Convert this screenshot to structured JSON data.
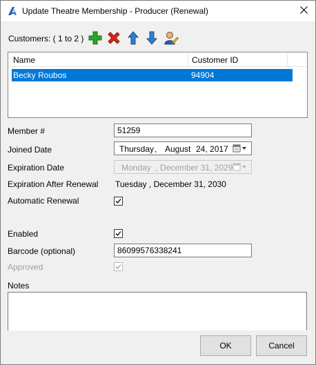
{
  "window": {
    "title": "Update Theatre Membership - Producer (Renewal)",
    "app_icon": "app-logo-icon",
    "close_icon": "close-icon"
  },
  "customers": {
    "label": "Customers:  ( 1 to 2 )",
    "toolbar_icons": [
      "add-icon",
      "delete-icon",
      "move-up-icon",
      "move-down-icon",
      "edit-user-icon"
    ],
    "columns": [
      "Name",
      "Customer ID"
    ],
    "rows": [
      {
        "name": "Becky Roubos",
        "customer_id": "94904",
        "selected": true
      }
    ]
  },
  "form": {
    "member_number": {
      "label": "Member #",
      "value": "51259"
    },
    "joined_date": {
      "label": "Joined Date",
      "weekday": "Thursday",
      "sep": ",",
      "month": "August",
      "day_year": "24, 2017"
    },
    "expiration_date": {
      "label": "Expiration Date",
      "weekday": "Monday",
      "sep": ",",
      "month_day_year": "December 31, 2029"
    },
    "expiration_after_renewal": {
      "label": "Expiration After Renewal",
      "value": "Tuesday , December 31, 2030"
    },
    "automatic_renewal": {
      "label": "Automatic Renewal",
      "checked": true
    },
    "enabled": {
      "label": "Enabled",
      "checked": true
    },
    "barcode": {
      "label": "Barcode (optional)",
      "value": "86099576338241"
    },
    "approved": {
      "label": "Approved",
      "checked": true,
      "disabled": true
    },
    "notes": {
      "label": "Notes",
      "value": ""
    }
  },
  "buttons": {
    "ok": "OK",
    "cancel": "Cancel"
  },
  "colors": {
    "selection": "#0078d7",
    "add_green": "#2ea32e",
    "delete_red": "#d9261c",
    "arrow_blue": "#2f7fd1"
  }
}
